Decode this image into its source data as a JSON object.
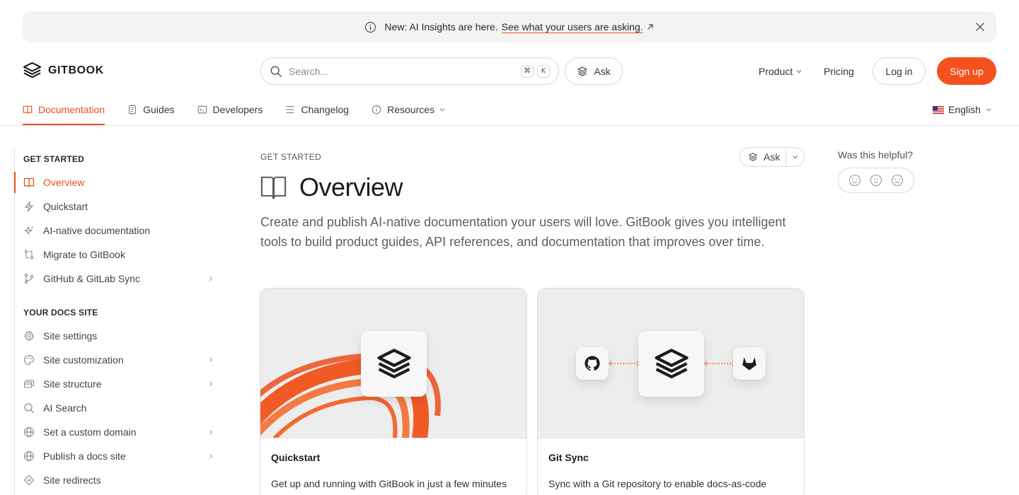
{
  "banner": {
    "text": "New: AI Insights are here.",
    "link": "See what your users are asking."
  },
  "header": {
    "brand": "GITBOOK",
    "search_placeholder": "Search...",
    "shortcut_keys": [
      "⌘",
      "K"
    ],
    "ask_label": "Ask",
    "product_label": "Product",
    "pricing_label": "Pricing",
    "login_label": "Log in",
    "signup_label": "Sign up"
  },
  "tabs": [
    {
      "label": "Documentation",
      "icon": "book-icon",
      "active": true
    },
    {
      "label": "Guides",
      "icon": "document-icon"
    },
    {
      "label": "Developers",
      "icon": "terminal-icon"
    },
    {
      "label": "Changelog",
      "icon": "list-icon"
    },
    {
      "label": "Resources",
      "icon": "info-icon",
      "dropdown": true
    }
  ],
  "language": "English",
  "sidebar": {
    "sections": [
      {
        "title": "GET STARTED",
        "items": [
          {
            "label": "Overview",
            "icon": "book-icon",
            "active": true
          },
          {
            "label": "Quickstart",
            "icon": "bolt-icon"
          },
          {
            "label": "AI-native documentation",
            "icon": "sparkle-icon"
          },
          {
            "label": "Migrate to GitBook",
            "icon": "migrate-icon"
          },
          {
            "label": "GitHub & GitLab Sync",
            "icon": "branch-icon",
            "chevron": true
          }
        ]
      },
      {
        "title": "YOUR DOCS SITE",
        "items": [
          {
            "label": "Site settings",
            "icon": "gear-icon"
          },
          {
            "label": "Site customization",
            "icon": "palette-icon",
            "chevron": true
          },
          {
            "label": "Site structure",
            "icon": "layers-icon",
            "chevron": true
          },
          {
            "label": "AI Search",
            "icon": "search-icon"
          },
          {
            "label": "Set a custom domain",
            "icon": "globe-icon",
            "chevron": true
          },
          {
            "label": "Publish a docs site",
            "icon": "globe-icon",
            "chevron": true
          },
          {
            "label": "Site redirects",
            "icon": "redirect-icon"
          }
        ]
      }
    ]
  },
  "page": {
    "breadcrumb": "GET STARTED",
    "ask_label": "Ask",
    "title": "Overview",
    "lead": "Create and publish AI-native documentation your users will love. GitBook gives you intelligent tools to build product guides, API references, and documentation that improves over time."
  },
  "cards": [
    {
      "title": "Quickstart",
      "desc": "Get up and running with GitBook in just a few minutes"
    },
    {
      "title": "Git Sync",
      "desc": "Sync with a Git repository to enable docs-as-code workflows"
    }
  ],
  "feedback": {
    "question": "Was this helpful?"
  },
  "colors": {
    "accent": "#f4511e",
    "active_text": "#e8501c"
  }
}
